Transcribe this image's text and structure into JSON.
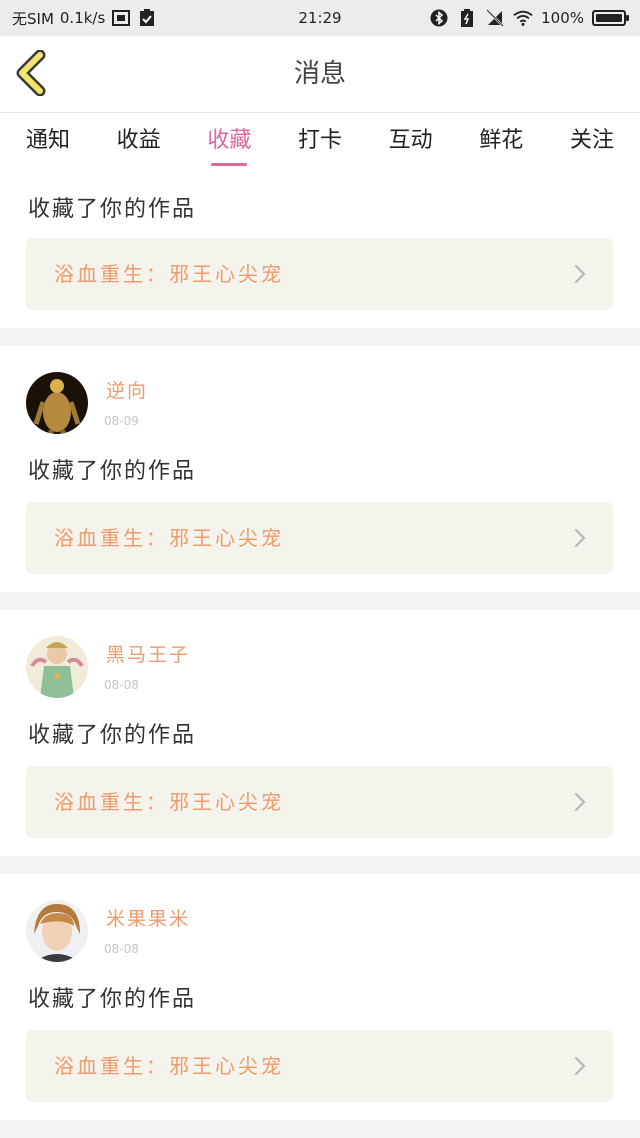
{
  "status_bar": {
    "carrier": "无SIM",
    "speed": "0.1k/s",
    "time": "21:29",
    "battery": "100%"
  },
  "header": {
    "title": "消息"
  },
  "tabs": [
    {
      "label": "通知",
      "active": false
    },
    {
      "label": "收益",
      "active": false
    },
    {
      "label": "收藏",
      "active": true
    },
    {
      "label": "打卡",
      "active": false
    },
    {
      "label": "互动",
      "active": false
    },
    {
      "label": "鲜花",
      "active": false
    },
    {
      "label": "关注",
      "active": false
    }
  ],
  "feed": {
    "first": {
      "action": "收藏了你的作品",
      "work_title": "浴血重生：邪王心尖宠"
    },
    "items": [
      {
        "name": "逆向",
        "date": "08-09",
        "action": "收藏了你的作品",
        "work_title": "浴血重生：邪王心尖宠"
      },
      {
        "name": "黑马王子",
        "date": "08-08",
        "action": "收藏了你的作品",
        "work_title": "浴血重生：邪王心尖宠"
      },
      {
        "name": "米果果米",
        "date": "08-08",
        "action": "收藏了你的作品",
        "work_title": "浴血重生：邪王心尖宠"
      }
    ]
  },
  "colors": {
    "accent_pink": "#e0669f",
    "name_orange": "#ee9a6c",
    "card_bg": "#f4f3ec",
    "back_arrow_yellow": "#f3e56b"
  }
}
